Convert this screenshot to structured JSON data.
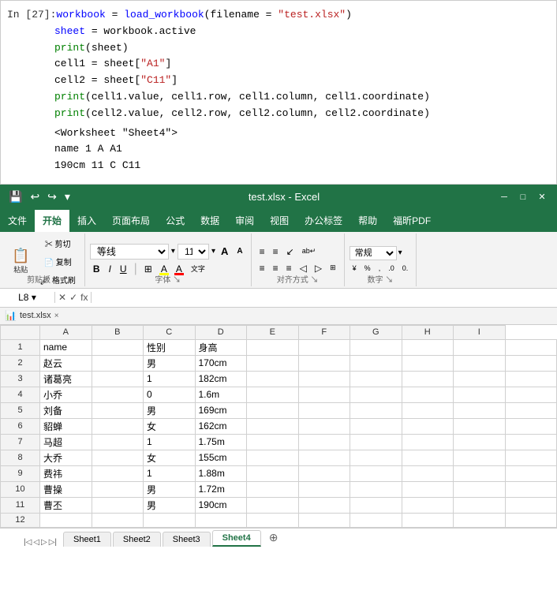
{
  "codeBlock": {
    "prompt": "In [27]:",
    "lines": [
      {
        "indent": "",
        "content": "workbook = load_workbook(filename = \"test.xlsx\")"
      },
      {
        "indent": "         ",
        "content": "sheet = workbook.active"
      },
      {
        "indent": "         ",
        "content": "print(sheet)"
      },
      {
        "indent": "         ",
        "content": "cell1 = sheet[\"A1\"]"
      },
      {
        "indent": "         ",
        "content": "cell2 = sheet[\"C11\"]"
      },
      {
        "indent": "         ",
        "content": "print(cell1.value, cell1.row, cell1.column, cell1.coordinate)"
      },
      {
        "indent": "         ",
        "content": "print(cell2.value, cell2.row, cell2.column, cell2.coordinate)"
      }
    ],
    "output": [
      "<Worksheet \"Sheet4\">",
      "name 1 A A1",
      "190cm 11 C C11"
    ]
  },
  "titlebar": {
    "title": "test.xlsx - Excel",
    "quickAccessIcons": [
      "💾",
      "↩",
      "↪",
      "▾"
    ]
  },
  "menubar": {
    "items": [
      "文件",
      "开始",
      "插入",
      "页面布局",
      "公式",
      "数据",
      "审阅",
      "视图",
      "办公标签",
      "帮助",
      "福昕PDF"
    ],
    "activeIndex": 1
  },
  "ribbon": {
    "groups": [
      {
        "name": "剪贴板",
        "items": [
          "粘贴",
          "剪切",
          "复制",
          "格式刷"
        ]
      },
      {
        "name": "字体",
        "fontName": "等线",
        "fontSize": "11",
        "formatButtons": [
          "B",
          "I",
          "U",
          "边框",
          "填充色",
          "字体颜色",
          "拼音"
        ]
      },
      {
        "name": "对齐方式",
        "items": [
          "左对齐",
          "居中",
          "右对齐",
          "自动换行",
          "合并"
        ]
      },
      {
        "name": "数字",
        "items": [
          "常规",
          "百分比",
          "千位",
          "小数"
        ]
      }
    ]
  },
  "formulaBar": {
    "cellRef": "L8",
    "formula": ""
  },
  "fileTab": {
    "name": "test.xlsx",
    "closeLabel": "×"
  },
  "spreadsheet": {
    "columnHeaders": [
      "",
      "A",
      "B",
      "C",
      "D",
      "E",
      "F",
      "G",
      "H",
      "I"
    ],
    "rows": [
      {
        "rowNum": "1",
        "cells": [
          "name",
          "",
          "性别",
          "身高",
          "",
          "",
          "",
          "",
          "",
          ""
        ]
      },
      {
        "rowNum": "2",
        "cells": [
          "赵云",
          "",
          "男",
          "170cm",
          "",
          "",
          "",
          "",
          "",
          ""
        ]
      },
      {
        "rowNum": "3",
        "cells": [
          "诸葛亮",
          "",
          "1",
          "182cm",
          "",
          "",
          "",
          "",
          "",
          ""
        ]
      },
      {
        "rowNum": "4",
        "cells": [
          "小乔",
          "",
          "0",
          "1.6m",
          "",
          "",
          "",
          "",
          "",
          ""
        ]
      },
      {
        "rowNum": "5",
        "cells": [
          "刘备",
          "",
          "男",
          "169cm",
          "",
          "",
          "",
          "",
          "",
          ""
        ]
      },
      {
        "rowNum": "6",
        "cells": [
          "貂蝉",
          "",
          "女",
          "162cm",
          "",
          "",
          "",
          "",
          "",
          ""
        ]
      },
      {
        "rowNum": "7",
        "cells": [
          "马超",
          "",
          "1",
          "1.75m",
          "",
          "",
          "",
          "",
          "",
          ""
        ]
      },
      {
        "rowNum": "8",
        "cells": [
          "大乔",
          "",
          "女",
          "155cm",
          "",
          "",
          "",
          "",
          "",
          ""
        ]
      },
      {
        "rowNum": "9",
        "cells": [
          "费祎",
          "",
          "1",
          "1.88m",
          "",
          "",
          "",
          "",
          "",
          ""
        ]
      },
      {
        "rowNum": "10",
        "cells": [
          "曹操",
          "",
          "男",
          "1.72m",
          "",
          "",
          "",
          "",
          "",
          ""
        ]
      },
      {
        "rowNum": "11",
        "cells": [
          "曹丕",
          "",
          "男",
          "190cm",
          "",
          "",
          "",
          "",
          "",
          ""
        ]
      },
      {
        "rowNum": "12",
        "cells": [
          "",
          "",
          "",
          "",
          "",
          "",
          "",
          "",
          "",
          ""
        ]
      }
    ]
  },
  "sheetTabs": {
    "tabs": [
      "Sheet1",
      "Sheet2",
      "Sheet3",
      "Sheet4"
    ],
    "activeTab": "Sheet4",
    "addLabel": "+"
  },
  "colors": {
    "excelGreen": "#217346",
    "toolbarBg": "#f3f3f3",
    "borderColor": "#d0d0d0"
  }
}
